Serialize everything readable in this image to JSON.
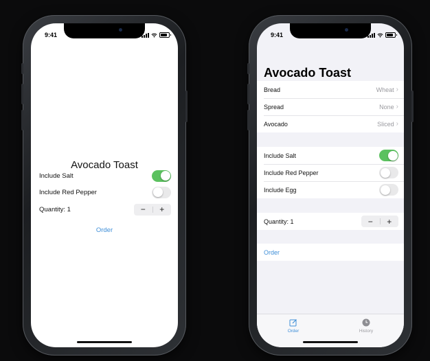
{
  "left_phone": {
    "status_time": "9:41",
    "title": "Avocado Toast",
    "rows": [
      {
        "label": "Include Salt",
        "on": true
      },
      {
        "label": "Include Red Pepper",
        "on": false
      }
    ],
    "quantity_label": "Quantity: 1",
    "stepper": {
      "minus": "−",
      "plus": "+"
    },
    "order_label": "Order"
  },
  "right_phone": {
    "status_time": "9:41",
    "title": "Avocado Toast",
    "details": [
      {
        "label": "Bread",
        "value": "Wheat"
      },
      {
        "label": "Spread",
        "value": "None"
      },
      {
        "label": "Avocado",
        "value": "Sliced"
      }
    ],
    "toggles": [
      {
        "label": "Include Salt",
        "on": true
      },
      {
        "label": "Include Red Pepper",
        "on": false
      },
      {
        "label": "Include Egg",
        "on": false
      }
    ],
    "quantity_label": "Quantity: 1",
    "stepper": {
      "minus": "−",
      "plus": "+"
    },
    "order_label": "Order",
    "tabs": [
      {
        "label": "Order",
        "icon": "compose-icon",
        "selected": true
      },
      {
        "label": "History",
        "icon": "clock-icon",
        "selected": false
      }
    ],
    "chevron": "›"
  },
  "colors": {
    "accent": "#3f8fd8",
    "toggle_on": "#5bc15f",
    "background": "#0b0b0c"
  }
}
